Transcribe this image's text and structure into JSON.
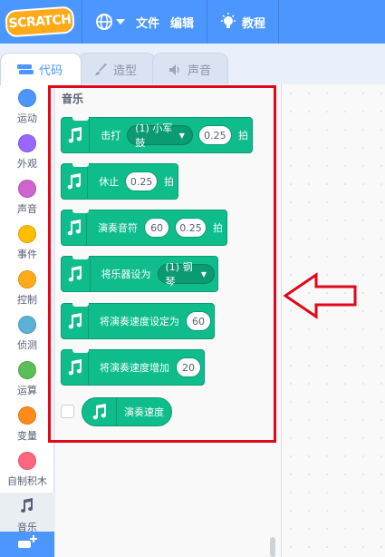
{
  "menubar": {
    "logo": "SCRATCH",
    "file": "文件",
    "edit": "编辑",
    "tutorials": "教程",
    "accent": "#4c97ff"
  },
  "tabs": [
    {
      "label": "代码",
      "icon": "code-icon",
      "active": true
    },
    {
      "label": "造型",
      "icon": "brush-icon",
      "active": false
    },
    {
      "label": "声音",
      "icon": "speaker-icon",
      "active": false
    }
  ],
  "categories": [
    {
      "label": "运动",
      "color": "#4c97ff"
    },
    {
      "label": "外观",
      "color": "#9966ff"
    },
    {
      "label": "声音",
      "color": "#cf63cf"
    },
    {
      "label": "事件",
      "color": "#ffbf00"
    },
    {
      "label": "控制",
      "color": "#ffab19"
    },
    {
      "label": "侦测",
      "color": "#5cb1d6"
    },
    {
      "label": "运算",
      "color": "#59c059"
    },
    {
      "label": "变量",
      "color": "#ff8c1a"
    },
    {
      "label": "自制积木",
      "color": "#ff6680"
    },
    {
      "label": "音乐",
      "icon": "music-note-icon",
      "selected": true
    }
  ],
  "palette": {
    "title": "音乐",
    "blocks": {
      "drum": {
        "label": "击打",
        "dropdown": "(1) 小军鼓",
        "value": "0.25",
        "suffix": "拍"
      },
      "rest": {
        "label": "休止",
        "value": "0.25",
        "suffix": "拍"
      },
      "note": {
        "label": "演奏音符",
        "note": "60",
        "value": "0.25",
        "suffix": "拍"
      },
      "instrument": {
        "label": "将乐器设为",
        "dropdown": "(1) 钢琴"
      },
      "set_tempo": {
        "label": "将演奏速度设定为",
        "value": "60"
      },
      "change_tempo": {
        "label": "将演奏速度增加",
        "value": "20"
      },
      "tempo": {
        "label": "演奏速度"
      }
    },
    "block_color": "#0fbd8c"
  },
  "annotation": {
    "highlight_color": "#e0081a"
  }
}
